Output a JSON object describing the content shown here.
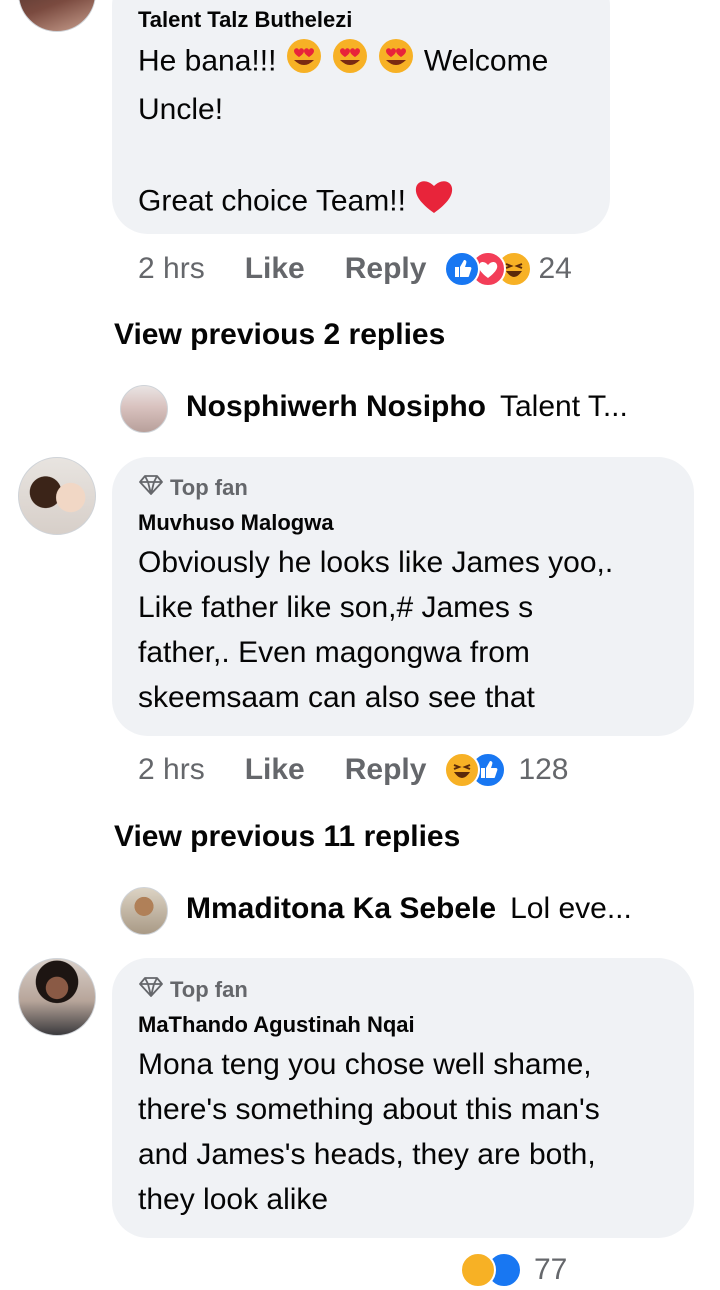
{
  "comments": [
    {
      "author": "Talent Talz Buthelezi",
      "text_line1": "He bana!!!",
      "text_line1_after": "Welcome",
      "text_line2": "Uncle!",
      "text_line3": "Great choice Team!!",
      "time": "2 hrs",
      "like_label": "Like",
      "reply_label": "Reply",
      "reaction_count": "24"
    },
    {
      "badge": "Top fan",
      "author": "Muvhuso Malogwa",
      "lines": [
        "Obviously he looks like James yoo,.",
        "Like father like son,# James s",
        "father,. Even magongwa from",
        "skeemsaam can also see that"
      ],
      "time": "2 hrs",
      "like_label": "Like",
      "reply_label": "Reply",
      "reaction_count": "128"
    },
    {
      "badge": "Top fan",
      "author": "MaThando Agustinah Nqai",
      "lines": [
        "Mona teng you chose well shame,",
        "there's something about this man's",
        "and James's heads, they are both,",
        "they look alike"
      ],
      "reaction_count": "77"
    }
  ],
  "view_previous": [
    {
      "label": "View previous 2 replies"
    },
    {
      "label": "View previous 11 replies"
    }
  ],
  "reply_previews": [
    {
      "name": "Nosphiwerh Nosipho",
      "text": "Talent T..."
    },
    {
      "name": "Mmaditona Ka Sebele",
      "text": "Lol eve..."
    }
  ],
  "colors": {
    "bubble": "#f0f2f5",
    "meta": "#65676b",
    "like_blue": "#1877f2",
    "love_red": "#f33e58",
    "haha_yellow": "#f7b125"
  },
  "icons": [
    "heart-eyes-emoji",
    "red-heart-emoji",
    "like-reaction-icon",
    "love-reaction-icon",
    "haha-reaction-icon",
    "diamond-icon"
  ]
}
